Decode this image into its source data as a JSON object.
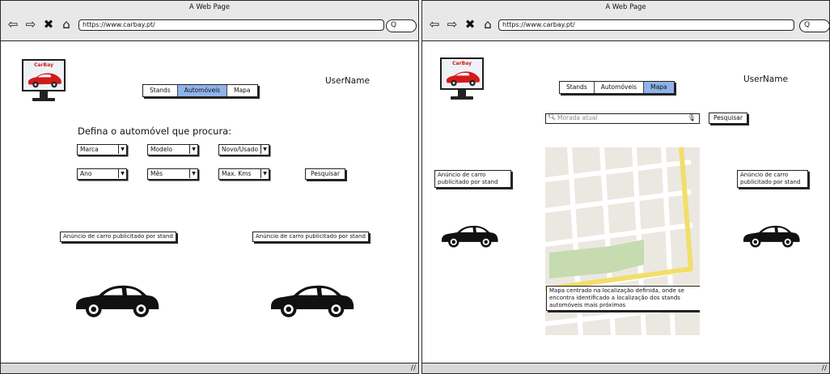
{
  "left": {
    "window_title": "A Web Page",
    "url": "https://www.carbay.pt/",
    "search_pill": "Q",
    "logo_text": "CarBay",
    "tabs": [
      "Stands",
      "Automóveis",
      "Mapa"
    ],
    "active_tab": "Automóveis",
    "username": "UserName",
    "heading": "Defina o automóvel que procura:",
    "filters_row1": [
      "Marca",
      "Modelo",
      "Novo/Usado"
    ],
    "filters_row2": [
      "Ano",
      "Mês",
      "Max. Kms"
    ],
    "search_button": "Pesquisar",
    "ad_left": "Anúncio de carro publicitado por stand",
    "ad_right": "Anúncio de carro publicitado por stand"
  },
  "right": {
    "window_title": "A Web Page",
    "url": "https://www.carbay.pt/",
    "search_pill": "Q",
    "logo_text": "CarBay",
    "tabs": [
      "Stands",
      "Automóveis",
      "Mapa"
    ],
    "active_tab": "Mapa",
    "username": "UserName",
    "search_placeholder": "Morada atual",
    "search_button": "Pesquisar",
    "ad_left": "Anúncio de carro publicitado por stand",
    "ad_right": "Anúncio de carro publicitado por stand",
    "map_note": "Mapa centrado na localização definida, onde se encontra identificado a localização dos stands automóveis mais próximos"
  },
  "icons": {
    "back": "arrow-left-icon",
    "forward": "arrow-right-icon",
    "stop": "close-icon",
    "home": "home-icon",
    "search": "search-icon",
    "mic": "microphone-icon",
    "dropdown": "chevron-down-icon",
    "car": "car-icon"
  },
  "colors": {
    "active_tab": "#8fb3ea",
    "map_road_yellow": "#f2de6a",
    "map_park": "#c6dbb0",
    "logo_red": "#d21a1a"
  }
}
